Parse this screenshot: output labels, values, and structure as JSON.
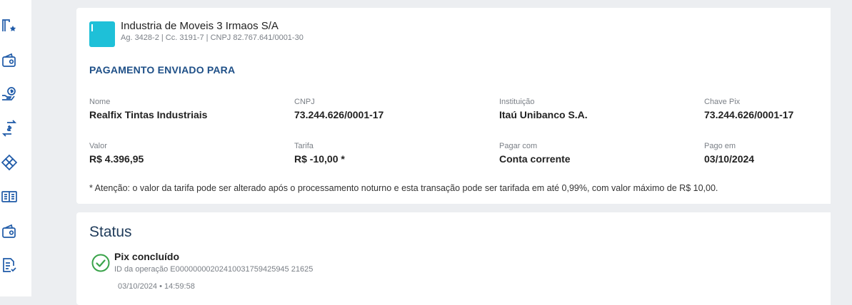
{
  "sidebar": {
    "icons": [
      {
        "name": "favorites-icon"
      },
      {
        "name": "wallet-icon"
      },
      {
        "name": "money-hand-icon"
      },
      {
        "name": "transfer-icon"
      },
      {
        "name": "pix-icon"
      },
      {
        "name": "statement-icon"
      },
      {
        "name": "wallet-2-icon"
      },
      {
        "name": "checklist-icon"
      }
    ]
  },
  "account": {
    "company": "Industria de Moveis 3 Irmaos S/A",
    "details": "Ag. 3428-2 | Cc. 3191-7 | CNPJ 82.767.641/0001-30"
  },
  "payment": {
    "section_title": "PAGAMENTO ENVIADO PARA",
    "fields": {
      "nome": {
        "label": "Nome",
        "value": "Realfix Tintas Industriais"
      },
      "cnpj": {
        "label": "CNPJ",
        "value": "73.244.626/0001-17"
      },
      "instituicao": {
        "label": "Instituição",
        "value": "Itaú Unibanco S.A."
      },
      "chave_pix": {
        "label": "Chave Pix",
        "value": "73.244.626/0001-17"
      },
      "valor": {
        "label": "Valor",
        "value": "R$ 4.396,95"
      },
      "tarifa": {
        "label": "Tarifa",
        "value": "R$ -10,00 *"
      },
      "pagar_com": {
        "label": "Pagar com",
        "value": "Conta corrente"
      },
      "pago_em": {
        "label": "Pago em",
        "value": "03/10/2024"
      }
    },
    "note": "* Atenção: o valor da tarifa pode ser alterado após o processamento noturno e esta transação pode ser tarifada em até 0,99%, com valor máximo de R$ 10,00."
  },
  "status": {
    "title": "Status",
    "label": "Pix concluído",
    "operation_id": "ID da operação E00000000202410031759425945 21625",
    "timestamp": "03/10/2024 • 14:59:58"
  },
  "colors": {
    "accent": "#1e4f87",
    "logo": "#1ec0d8",
    "success": "#3aa34a",
    "icon": "#1e5aa8"
  }
}
